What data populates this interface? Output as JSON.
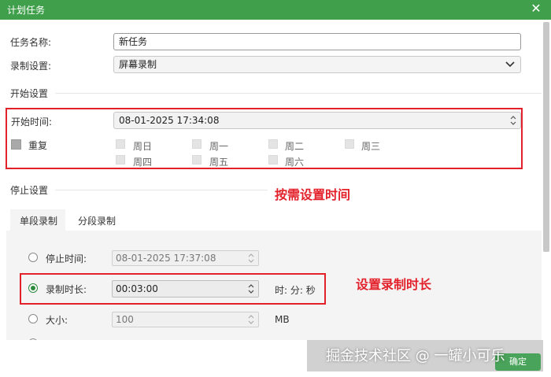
{
  "window": {
    "title": "计划任务"
  },
  "form": {
    "task_name_label": "任务名称:",
    "task_name_value": "新任务",
    "record_setting_label": "录制设置:",
    "record_setting_value": "屏幕录制"
  },
  "start": {
    "section_title": "开始设置",
    "start_time_label": "开始时间:",
    "start_time_value": "08-01-2025 17:34:08",
    "repeat_label": "重复",
    "days": [
      "周日",
      "周一",
      "周二",
      "周三",
      "周四",
      "周五",
      "周六"
    ]
  },
  "stop": {
    "section_title": "停止设置",
    "tabs": [
      "单段录制",
      "分段录制"
    ],
    "stop_time_label": "停止时间:",
    "stop_time_value": "08-01-2025 17:37:08",
    "duration_label": "录制时长:",
    "duration_value": "00:03:00",
    "duration_unit": "时: 分: 秒",
    "size_label": "大小:",
    "size_value": "100",
    "size_unit": "MB"
  },
  "annotations": {
    "time_note": "按需设置时间",
    "duration_note": "设置录制时长"
  },
  "footer": {
    "ok_label": "确定",
    "watermark": "掘金技术社区 @ 一罐小可乐"
  },
  "colors": {
    "accent": "#3f9f4b",
    "annotation": "#e3212b"
  }
}
